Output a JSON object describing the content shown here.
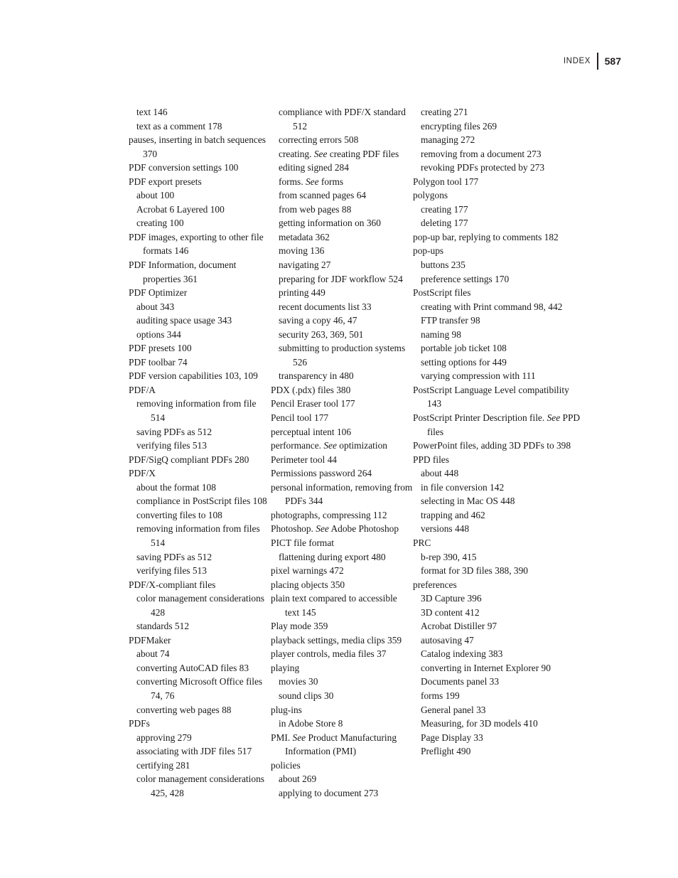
{
  "header": {
    "label": "INDEX",
    "page_number": "587"
  },
  "columns": [
    {
      "id": "column-1",
      "entries": [
        {
          "level": 1,
          "text": "text 146"
        },
        {
          "level": 1,
          "text": "text as a comment 178"
        },
        {
          "level": 0,
          "text": "pauses, inserting in batch sequences 370"
        },
        {
          "level": 0,
          "text": "PDF conversion settings 100"
        },
        {
          "level": 0,
          "text": "PDF export presets"
        },
        {
          "level": 1,
          "text": "about 100"
        },
        {
          "level": 1,
          "text": "Acrobat 6 Layered 100"
        },
        {
          "level": 1,
          "text": "creating 100"
        },
        {
          "level": 0,
          "text": "PDF images, exporting to other file formats 146"
        },
        {
          "level": 0,
          "text": "PDF Information, document properties 361"
        },
        {
          "level": 0,
          "text": "PDF Optimizer"
        },
        {
          "level": 1,
          "text": "about 343"
        },
        {
          "level": 1,
          "text": "auditing space usage 343"
        },
        {
          "level": 1,
          "text": "options 344"
        },
        {
          "level": 0,
          "text": "PDF presets 100"
        },
        {
          "level": 0,
          "text": "PDF toolbar 74"
        },
        {
          "level": 0,
          "text": "PDF version capabilities 103, 109"
        },
        {
          "level": 0,
          "text": "PDF/A"
        },
        {
          "level": 1,
          "text": "removing information from file 514"
        },
        {
          "level": 1,
          "text": "saving PDFs as 512"
        },
        {
          "level": 1,
          "text": "verifying files 513"
        },
        {
          "level": 0,
          "text": "PDF/SigQ compliant PDFs 280"
        },
        {
          "level": 0,
          "text": "PDF/X"
        },
        {
          "level": 1,
          "text": "about the format 108"
        },
        {
          "level": 1,
          "text": "compliance in PostScript files 108"
        },
        {
          "level": 1,
          "text": "converting files to 108"
        },
        {
          "level": 1,
          "text": "removing information from files 514"
        },
        {
          "level": 1,
          "text": "saving PDFs as 512"
        },
        {
          "level": 1,
          "text": "verifying files 513"
        },
        {
          "level": 0,
          "text": "PDF/X-compliant files"
        },
        {
          "level": 1,
          "text": "color management considerations 428"
        },
        {
          "level": 1,
          "text": "standards 512"
        },
        {
          "level": 0,
          "text": "PDFMaker"
        },
        {
          "level": 1,
          "text": "about 74"
        },
        {
          "level": 1,
          "text": "converting AutoCAD files 83"
        },
        {
          "level": 1,
          "text": "converting Microsoft Office files 74, 76"
        },
        {
          "level": 1,
          "text": "converting web pages 88"
        },
        {
          "level": 0,
          "text": "PDFs"
        },
        {
          "level": 1,
          "text": "approving 279"
        },
        {
          "level": 1,
          "text": "associating with JDF files 517"
        },
        {
          "level": 1,
          "text": "certifying 281"
        },
        {
          "level": 1,
          "text": "color management considerations 425, 428"
        }
      ]
    },
    {
      "id": "column-2",
      "entries": [
        {
          "level": 1,
          "text": "compliance with PDF/X standard 512"
        },
        {
          "level": 1,
          "text": "correcting errors 508"
        },
        {
          "level": 1,
          "html": "creating. <i>See</i> creating PDF files",
          "text": "creating. See creating PDF files"
        },
        {
          "level": 1,
          "text": "editing signed 284"
        },
        {
          "level": 1,
          "html": "forms. <i>See</i> forms",
          "text": "forms. See forms"
        },
        {
          "level": 1,
          "text": "from scanned pages 64"
        },
        {
          "level": 1,
          "text": "from web pages 88"
        },
        {
          "level": 1,
          "text": "getting information on 360"
        },
        {
          "level": 1,
          "text": "metadata 362"
        },
        {
          "level": 1,
          "text": "moving 136"
        },
        {
          "level": 1,
          "text": "navigating 27"
        },
        {
          "level": 1,
          "text": "preparing for JDF workflow 524"
        },
        {
          "level": 1,
          "text": "printing 449"
        },
        {
          "level": 1,
          "text": "recent documents list 33"
        },
        {
          "level": 1,
          "text": "saving a copy 46, 47"
        },
        {
          "level": 1,
          "text": "security 263, 369, 501"
        },
        {
          "level": 1,
          "text": "submitting to production systems 526"
        },
        {
          "level": 1,
          "text": "transparency in 480"
        },
        {
          "level": 0,
          "text": "PDX (.pdx) files 380"
        },
        {
          "level": 0,
          "text": "Pencil Eraser tool 177"
        },
        {
          "level": 0,
          "text": "Pencil tool 177"
        },
        {
          "level": 0,
          "text": "perceptual intent 106"
        },
        {
          "level": 0,
          "html": "performance. <i>See</i> optimization",
          "text": "performance. See optimization"
        },
        {
          "level": 0,
          "text": "Perimeter tool 44"
        },
        {
          "level": 0,
          "text": "Permissions password 264"
        },
        {
          "level": 0,
          "text": "personal information, removing from PDFs 344"
        },
        {
          "level": 0,
          "text": "photographs, compressing 112"
        },
        {
          "level": 0,
          "html": "Photoshop. <i>See</i> Adobe Photoshop",
          "text": "Photoshop. See Adobe Photoshop"
        },
        {
          "level": 0,
          "text": "PICT file format"
        },
        {
          "level": 1,
          "text": "flattening during export 480"
        },
        {
          "level": 0,
          "text": "pixel warnings 472"
        },
        {
          "level": 0,
          "text": "placing objects 350"
        },
        {
          "level": 0,
          "text": "plain text compared to accessible text 145"
        },
        {
          "level": 0,
          "text": "Play mode 359"
        },
        {
          "level": 0,
          "text": "playback settings, media clips 359"
        },
        {
          "level": 0,
          "text": "player controls, media files 37"
        },
        {
          "level": 0,
          "text": "playing"
        },
        {
          "level": 1,
          "text": "movies 30"
        },
        {
          "level": 1,
          "text": "sound clips 30"
        },
        {
          "level": 0,
          "text": "plug-ins"
        },
        {
          "level": 1,
          "text": "in Adobe Store 8"
        },
        {
          "level": 0,
          "html": "PMI. <i>See</i> Product Manufacturing Information (PMI)",
          "text": "PMI. See Product Manufacturing Information (PMI)"
        },
        {
          "level": 0,
          "text": "policies"
        },
        {
          "level": 1,
          "text": "about 269"
        },
        {
          "level": 1,
          "text": "applying to document 273"
        }
      ]
    },
    {
      "id": "column-3",
      "entries": [
        {
          "level": 1,
          "text": "creating 271"
        },
        {
          "level": 1,
          "text": "encrypting files 269"
        },
        {
          "level": 1,
          "text": "managing 272"
        },
        {
          "level": 1,
          "text": "removing from a document 273"
        },
        {
          "level": 1,
          "text": "revoking PDFs protected by 273"
        },
        {
          "level": 0,
          "text": "Polygon tool 177"
        },
        {
          "level": 0,
          "text": "polygons"
        },
        {
          "level": 1,
          "text": "creating 177"
        },
        {
          "level": 1,
          "text": "deleting 177"
        },
        {
          "level": 0,
          "text": "pop-up bar, replying to comments 182"
        },
        {
          "level": 0,
          "text": "pop-ups"
        },
        {
          "level": 1,
          "text": "buttons 235"
        },
        {
          "level": 1,
          "text": "preference settings 170"
        },
        {
          "level": 0,
          "text": "PostScript files"
        },
        {
          "level": 1,
          "text": "creating with Print command 98, 442"
        },
        {
          "level": 1,
          "text": "FTP transfer 98"
        },
        {
          "level": 1,
          "text": "naming 98"
        },
        {
          "level": 1,
          "text": "portable job ticket 108"
        },
        {
          "level": 1,
          "text": "setting options for 449"
        },
        {
          "level": 1,
          "text": "varying compression with 111"
        },
        {
          "level": 0,
          "text": "PostScript Language Level compatibility 143"
        },
        {
          "level": 0,
          "html": "PostScript Printer Description file. <i>See</i> PPD files",
          "text": "PostScript Printer Description file. See PPD files"
        },
        {
          "level": 0,
          "text": "PowerPoint files, adding 3D PDFs to 398"
        },
        {
          "level": 0,
          "text": "PPD files"
        },
        {
          "level": 1,
          "text": "about 448"
        },
        {
          "level": 1,
          "text": "in file conversion 142"
        },
        {
          "level": 1,
          "text": "selecting in Mac OS 448"
        },
        {
          "level": 1,
          "text": "trapping and 462"
        },
        {
          "level": 1,
          "text": "versions 448"
        },
        {
          "level": 0,
          "text": "PRC"
        },
        {
          "level": 1,
          "text": "b-rep 390, 415"
        },
        {
          "level": 1,
          "text": "format for 3D files 388, 390"
        },
        {
          "level": 0,
          "text": "preferences"
        },
        {
          "level": 1,
          "text": "3D Capture 396"
        },
        {
          "level": 1,
          "text": "3D content 412"
        },
        {
          "level": 1,
          "text": "Acrobat Distiller 97"
        },
        {
          "level": 1,
          "text": "autosaving 47"
        },
        {
          "level": 1,
          "text": "Catalog indexing 383"
        },
        {
          "level": 1,
          "text": "converting in Internet Explorer 90"
        },
        {
          "level": 1,
          "text": "Documents panel 33"
        },
        {
          "level": 1,
          "text": "forms 199"
        },
        {
          "level": 1,
          "text": "General panel 33"
        },
        {
          "level": 1,
          "text": "Measuring, for 3D models 410"
        },
        {
          "level": 1,
          "text": "Page Display 33"
        },
        {
          "level": 1,
          "text": "Preflight 490"
        }
      ]
    }
  ]
}
